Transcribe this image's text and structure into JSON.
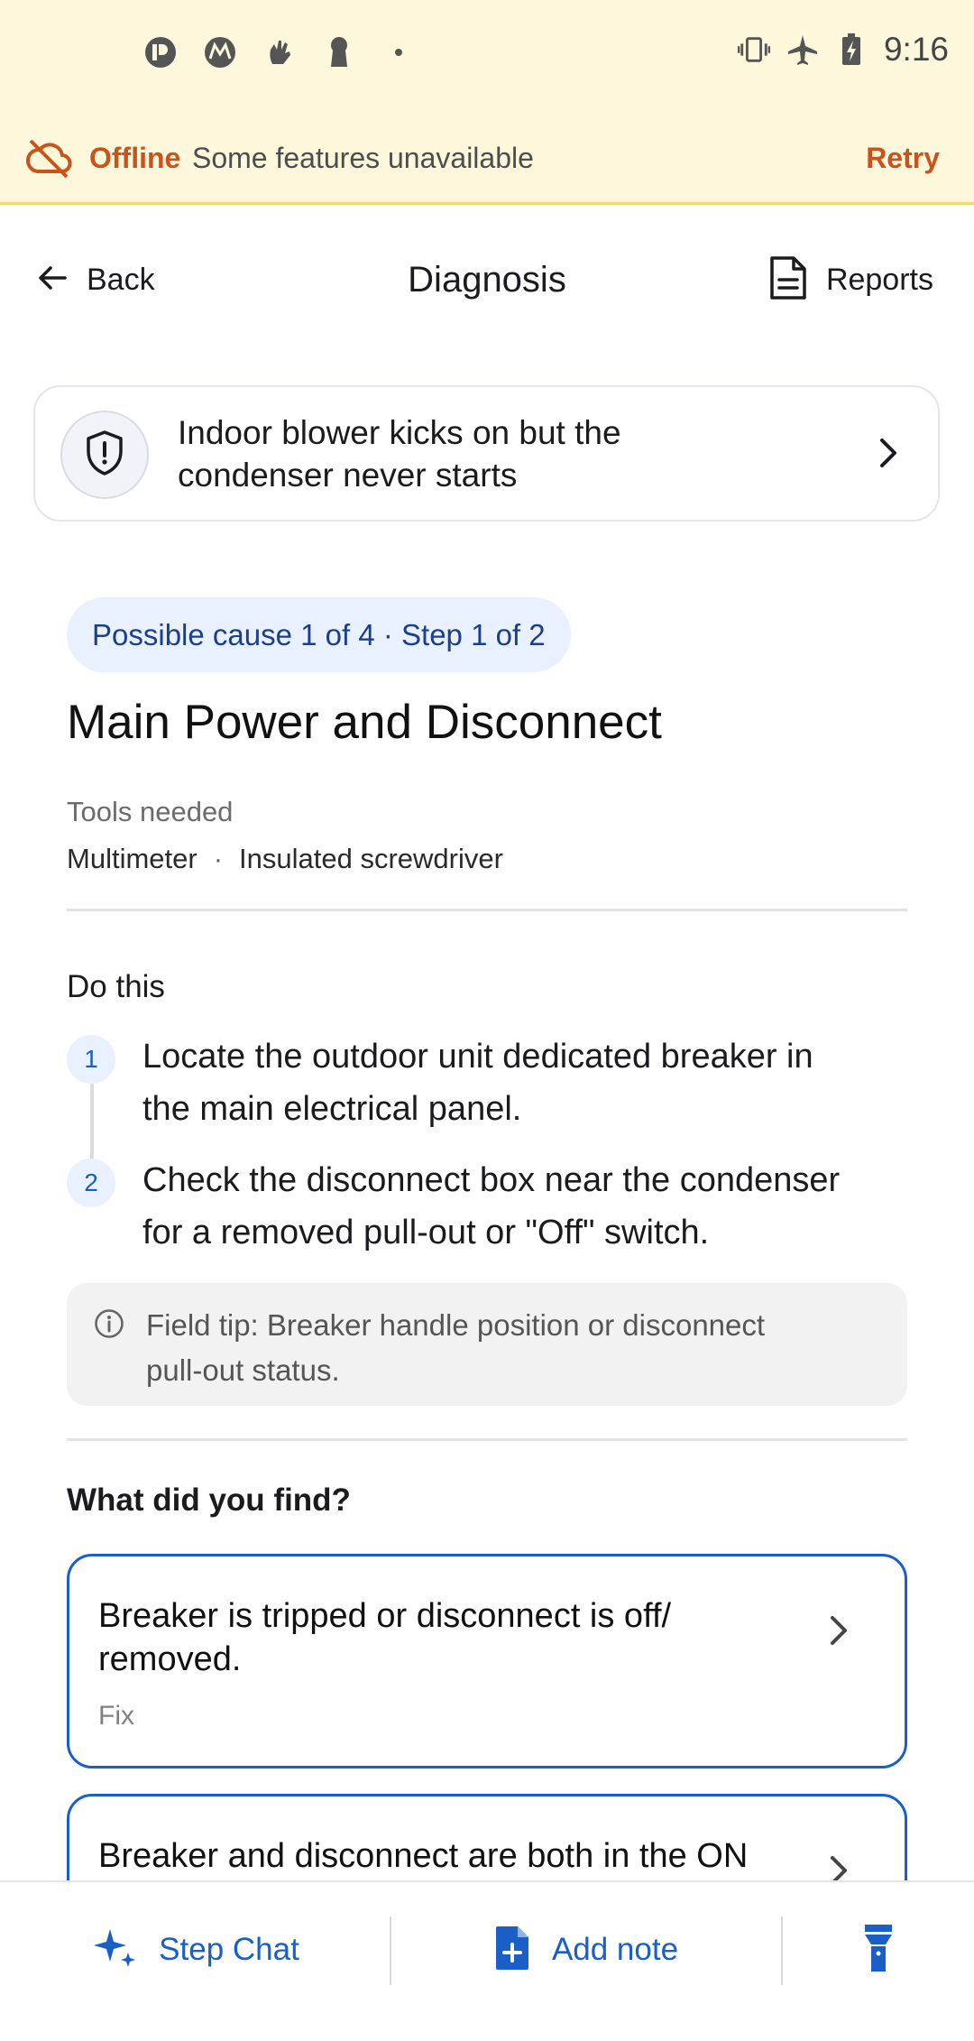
{
  "status_bar": {
    "time": "9:16",
    "left_icons": [
      "p-app-icon",
      "motorola-icon",
      "hand-icon",
      "keyhole-icon",
      "dot-icon"
    ],
    "right_icons": [
      "vibrate-icon",
      "airplane-icon",
      "battery-charging-icon"
    ]
  },
  "offline_banner": {
    "label": "Offline",
    "message": "Some features unavailable",
    "action": "Retry",
    "accent_color": "#c9531a",
    "background": "#fdf7dc"
  },
  "header": {
    "back_label": "Back",
    "title": "Diagnosis",
    "reports_label": "Reports"
  },
  "symptom": {
    "line1": "Indoor blower kicks on but the",
    "line2": "condenser never starts"
  },
  "progress_pill": "Possible cause 1 of 4 · Step 1 of 2",
  "main_heading": "Main Power and Disconnect",
  "tools": {
    "label": "Tools needed",
    "items": [
      "Multimeter",
      "Insulated screwdriver"
    ],
    "separator": "·"
  },
  "do_this": {
    "label": "Do this",
    "steps": [
      {
        "number": "1",
        "line1": "Locate the outdoor unit dedicated breaker in",
        "line2": "the main electrical panel."
      },
      {
        "number": "2",
        "line1": "Check the disconnect box near the condenser",
        "line2": "for a removed pull-out or \"Off\" switch."
      }
    ]
  },
  "field_tip": {
    "line1": "Field tip: Breaker handle position or disconnect",
    "line2": "pull-out status."
  },
  "findings": {
    "label": "What did you find?",
    "options": [
      {
        "line1": "Breaker is tripped or disconnect is off/",
        "line2": "removed.",
        "tag": "Fix"
      },
      {
        "line1": "Breaker and disconnect are both in the ON"
      }
    ]
  },
  "bottom_bar": {
    "step_chat": "Step Chat",
    "add_note": "Add note",
    "third_icon": "flashlight-icon",
    "accent_color": "#1a5fc8"
  }
}
